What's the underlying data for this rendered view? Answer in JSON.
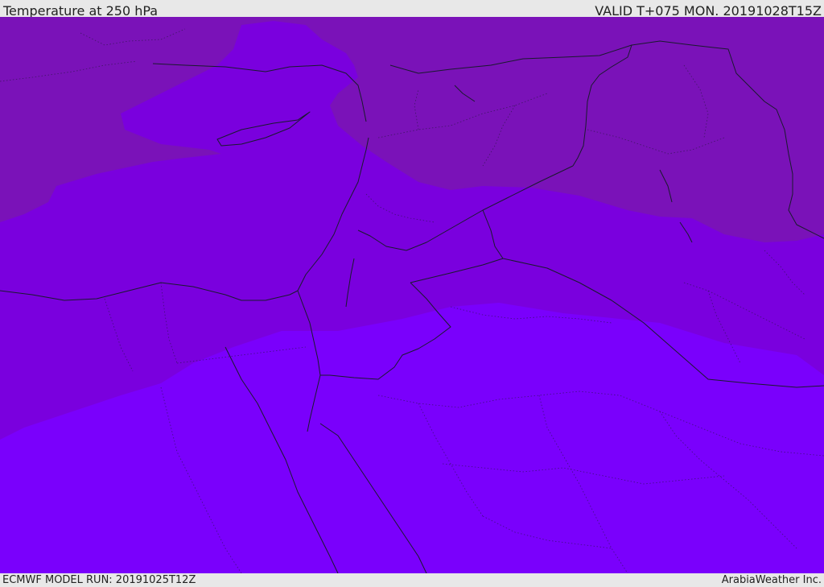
{
  "header": {
    "title": "Temperature at 250 hPa",
    "valid": "VALID T+075 MON. 20191028T15Z"
  },
  "footer": {
    "model_run": "ECMWF MODEL RUN: 20191025T12Z",
    "brand": "ArabiaWeather Inc."
  },
  "map": {
    "field": "temperature",
    "level": "250 hPa",
    "colors": {
      "zone_warm": "#7a00fc",
      "zone_mid": "#7a00de",
      "zone_cool": "#7a12b8",
      "borders": "#1a1a2e"
    }
  }
}
